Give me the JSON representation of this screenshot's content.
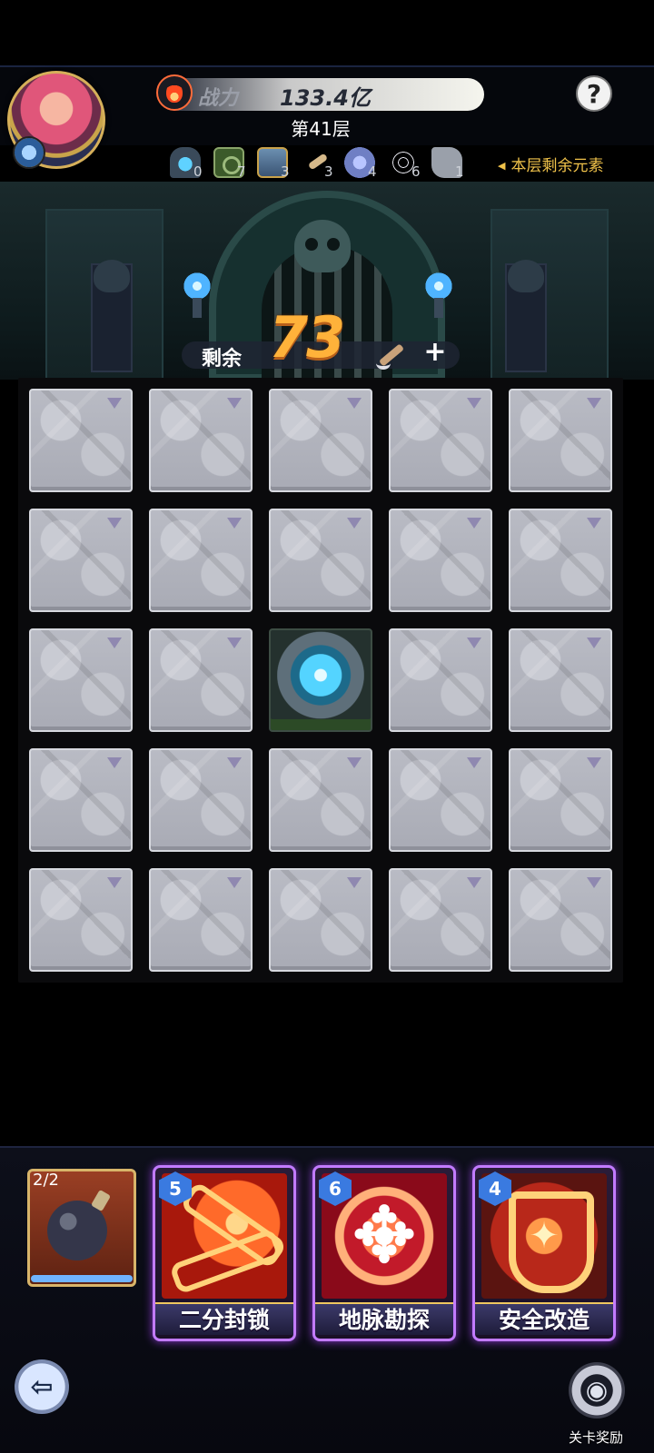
{
  "hud": {
    "power_label": "战力",
    "power_value": "133.4亿",
    "floor": "第41层",
    "help": "?"
  },
  "elements": {
    "label": "本层剩余元素",
    "items": [
      {
        "icon": "portal-icon",
        "count": "0"
      },
      {
        "icon": "block-icon",
        "count": "7"
      },
      {
        "icon": "chest-icon",
        "count": "3"
      },
      {
        "icon": "pickaxe-icon",
        "count": "3"
      },
      {
        "icon": "shield-icon",
        "count": "4"
      },
      {
        "icon": "spiderweb-icon",
        "count": "6"
      },
      {
        "icon": "puzzle-icon",
        "count": "1"
      }
    ]
  },
  "remaining": {
    "label": "剩余",
    "value": "73",
    "plus": "+"
  },
  "board": {
    "rows": 5,
    "cols": 5,
    "portal_cell": {
      "row": 2,
      "col": 2
    }
  },
  "bomb": {
    "count": "2/2",
    "progress": 1.0
  },
  "skills": [
    {
      "name": "二分封锁",
      "cost": "5",
      "art": "chain"
    },
    {
      "name": "地脉勘探",
      "cost": "6",
      "art": "swirl"
    },
    {
      "name": "安全改造",
      "cost": "4",
      "art": "shield"
    }
  ],
  "footer": {
    "reward_label": "关卡奖励",
    "exit_glyph": "⇦"
  },
  "colors": {
    "accent": "#ffb23a",
    "card_glow": "#c27bff",
    "elements_label": "#f0c24a"
  }
}
